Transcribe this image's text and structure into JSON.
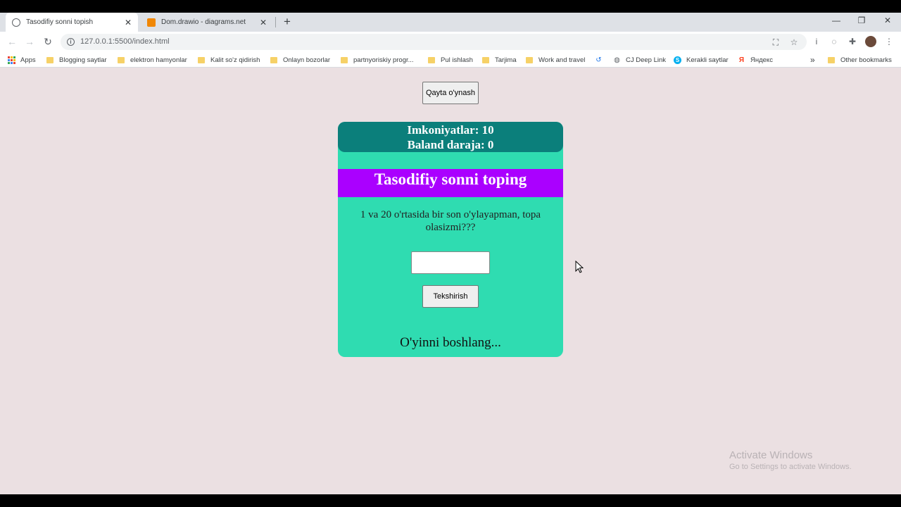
{
  "browser": {
    "tabs": [
      {
        "title": "Tasodifiy sonni topish",
        "active": true
      },
      {
        "title": "Dom.drawio - diagrams.net",
        "active": false
      }
    ],
    "url": "127.0.0.1:5500/index.html",
    "bookmarks": [
      {
        "label": "Apps",
        "icon": "apps-grid-icon"
      },
      {
        "label": "Blogging saytlar",
        "icon": "folder-icon"
      },
      {
        "label": "elektron hamyonlar",
        "icon": "folder-icon"
      },
      {
        "label": "Kalit so'z qidirish",
        "icon": "folder-icon"
      },
      {
        "label": "Onlayn bozorlar",
        "icon": "folder-icon"
      },
      {
        "label": "partnyoriskiy progr...",
        "icon": "folder-icon"
      },
      {
        "label": "Pul ishlash",
        "icon": "folder-icon"
      },
      {
        "label": "Tarjima",
        "icon": "folder-icon"
      },
      {
        "label": "Work and travel",
        "icon": "folder-icon"
      },
      {
        "label": "",
        "icon": "history-icon"
      },
      {
        "label": "CJ Deep Link",
        "icon": "globe-icon"
      },
      {
        "label": "Kerakli saytlar",
        "icon": "skype-icon"
      },
      {
        "label": "Яндекс",
        "icon": "yandex-icon"
      },
      {
        "label": "Other bookmarks",
        "icon": "folder-icon"
      }
    ],
    "overflow_label": "»"
  },
  "game": {
    "restart_label": "Qayta o'ynash",
    "attempts_label": "Imkoniyatlar: 10",
    "highscore_label": "Baland daraja: 0",
    "title": "Tasodifiy sonni toping",
    "prompt": "1 va 20 o'rtasida bir son o'ylayapman, topa olasizmi???",
    "input_value": "",
    "check_label": "Tekshirish",
    "message": "O'yinni boshlang..."
  },
  "watermark": {
    "line1": "Activate Windows",
    "line2": "Go to Settings to activate Windows."
  },
  "colors": {
    "page_bg": "#ebe0e2",
    "card_bg": "#2fdcb1",
    "stats_bg": "#0b7f7b",
    "banner_bg": "#aa00ff"
  }
}
